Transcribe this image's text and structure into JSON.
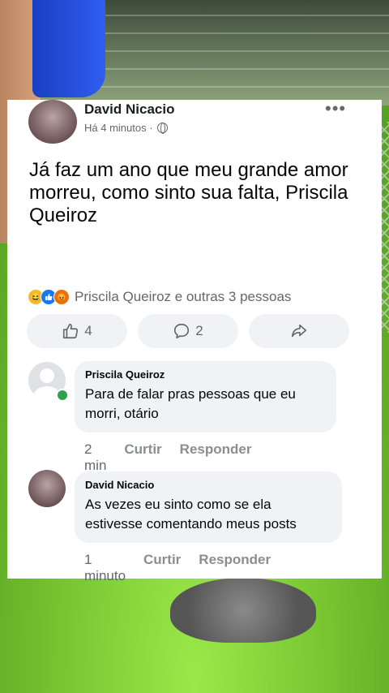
{
  "post": {
    "author": "David Nicacio",
    "time": "Há 4 minutos ·",
    "text": "Já faz um ano que meu grande amor morreu, como sinto sua falta, Priscila Queiroz",
    "reactions_text": "Priscila Queiroz e outras 3 pessoas",
    "like_count": "4",
    "comment_count": "2"
  },
  "comments": [
    {
      "author": "Priscila Queiroz",
      "text": "Para de falar pras pessoas que eu morri, otário",
      "time": "2 min",
      "like_label": "Curtir",
      "reply_label": "Responder"
    },
    {
      "author": "David Nicacio",
      "text": "As vezes eu sinto como se ela estivesse comentando meus posts",
      "time": "1 minuto",
      "like_label": "Curtir",
      "reply_label": "Responder"
    }
  ],
  "icons": {
    "more": "more-options-icon",
    "globe": "globe-icon",
    "like": "thumbs-up-icon",
    "comment": "comment-icon",
    "share": "share-icon"
  },
  "colors": {
    "facebook_blue": "#1877f2",
    "bubble_bg": "#f0f2f5",
    "online_green": "#31a24c",
    "secondary_text": "#65676b"
  }
}
